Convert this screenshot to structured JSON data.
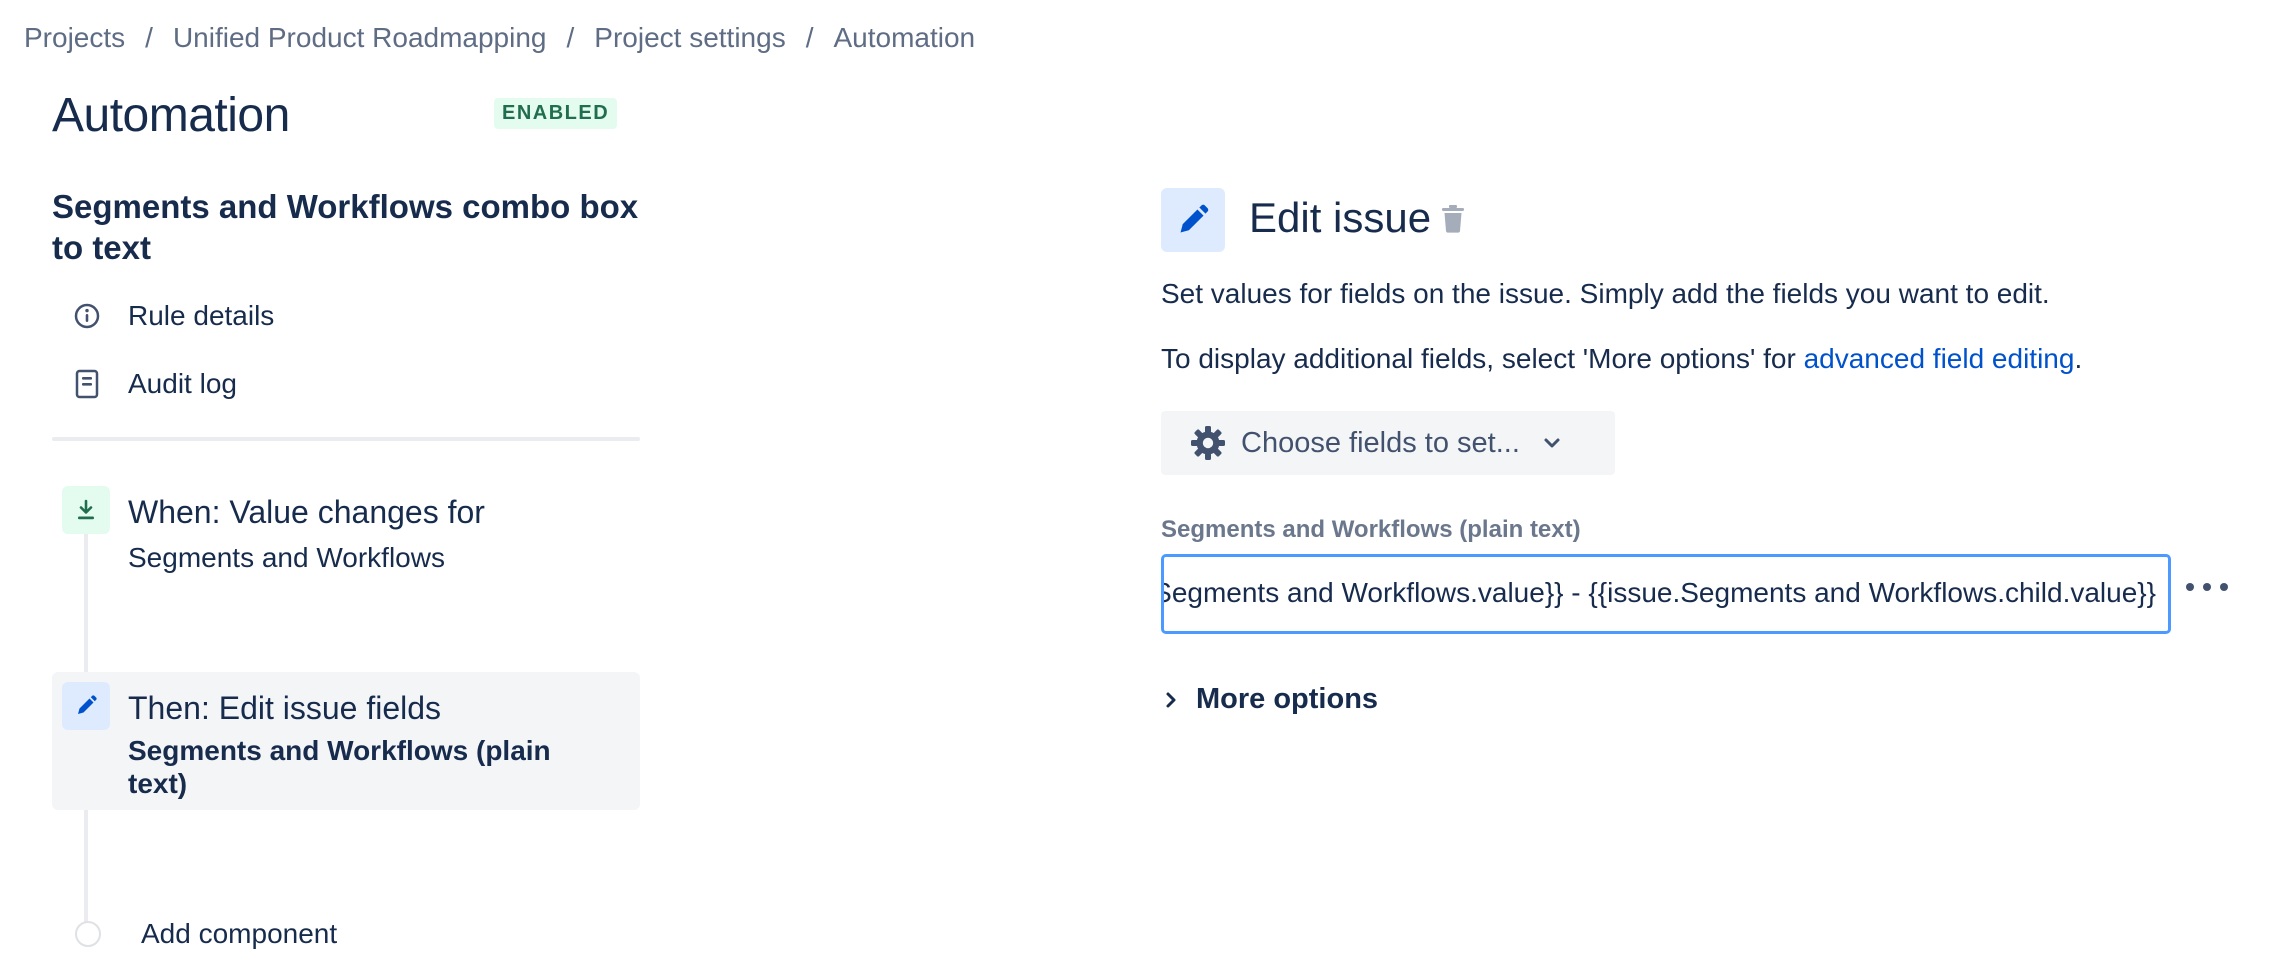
{
  "breadcrumb": {
    "items": [
      "Projects",
      "Unified Product Roadmapping",
      "Project settings",
      "Automation"
    ],
    "separator": "/"
  },
  "page": {
    "title": "Automation",
    "status": "ENABLED"
  },
  "sidebar": {
    "rule_name": "Segments and Workflows combo box to text",
    "links": {
      "rule_details": "Rule details",
      "audit_log": "Audit log"
    },
    "trigger": {
      "title": "When: Value changes for",
      "subtitle": "Segments and Workflows",
      "icon": "trigger-download-icon"
    },
    "action": {
      "title": "Then: Edit issue fields",
      "subtitle": "Segments and Workflows (plain text)",
      "icon": "pencil-icon"
    },
    "add_component": "Add component"
  },
  "panel": {
    "title": "Edit issue",
    "description": "Set values for fields on the issue. Simply add the fields you want to edit.",
    "additional_prefix": "To display additional fields, select 'More options' for ",
    "additional_link": "advanced field editing",
    "additional_suffix": ".",
    "choose_fields_label": "Choose fields to set...",
    "field_label": "Segments and Workflows (plain text)",
    "field_value": "{{issue.Segments and Workflows.value}} - {{issue.Segments and Workflows.child.value}}",
    "more_options": "More options"
  },
  "colors": {
    "text": "#172b4d",
    "subtle_text": "#5e6c84",
    "link": "#0052cc",
    "badge_bg": "#e3fcef",
    "badge_text": "#216e4e",
    "focus_border": "#4c9aff",
    "action_icon_bg": "#deebff"
  }
}
